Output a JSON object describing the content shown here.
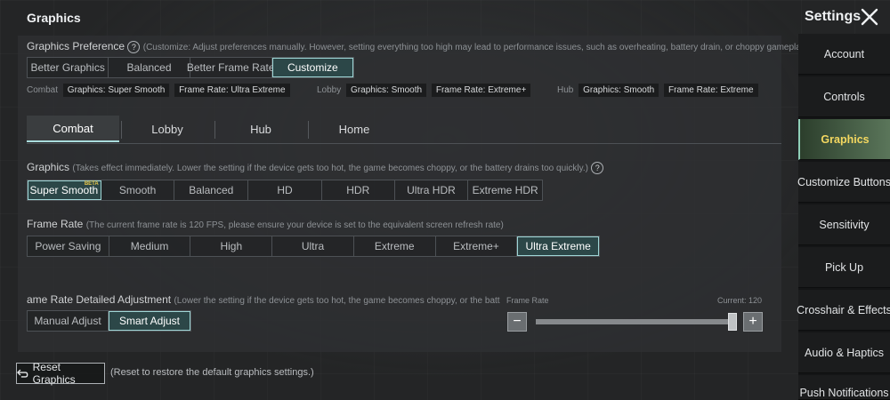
{
  "header": {
    "title": "Graphics",
    "settings_title": "Settings"
  },
  "preference": {
    "label": "Graphics Preference",
    "hint": "(Customize: Adjust preferences manually. However, setting everything too high may lead to performance issues, such as overheating, battery drain, or choppy gameplay.)",
    "options": [
      "Better Graphics",
      "Balanced",
      "Better Frame Rate",
      "Customize"
    ],
    "selected": "Customize",
    "summaries": {
      "combat": {
        "label": "Combat",
        "graphics": "Graphics: Super Smooth",
        "frame_rate": "Frame Rate: Ultra Extreme"
      },
      "lobby": {
        "label": "Lobby",
        "graphics": "Graphics: Smooth",
        "frame_rate": "Frame Rate: Extreme+"
      },
      "hub": {
        "label": "Hub",
        "graphics": "Graphics: Smooth",
        "frame_rate": "Frame Rate: Extreme"
      }
    }
  },
  "tabs": [
    "Combat",
    "Lobby",
    "Hub",
    "Home"
  ],
  "active_tab": "Combat",
  "graphics": {
    "label": "Graphics",
    "hint": "(Takes effect immediately. Lower the setting if the device gets too hot, the game becomes choppy, or the battery drains too quickly.)",
    "options": [
      "Super Smooth",
      "Smooth",
      "Balanced",
      "HD",
      "HDR",
      "Ultra HDR",
      "Extreme HDR"
    ],
    "selected": "Super Smooth",
    "beta_badge": "BETA"
  },
  "frame_rate": {
    "label": "Frame Rate",
    "hint": "(The current frame rate is 120 FPS, please ensure your device is set to the equivalent screen refresh rate)",
    "options": [
      "Power Saving",
      "Medium",
      "High",
      "Ultra",
      "Extreme",
      "Extreme+",
      "Ultra Extreme"
    ],
    "selected": "Ultra Extreme"
  },
  "detailed": {
    "label": "ame Rate Detailed Adjustment",
    "hint": "(Lower the setting if the device gets too hot, the game becomes choppy, or the battery drains",
    "options": [
      "Manual Adjust",
      "Smart Adjust"
    ],
    "selected": "Smart Adjust",
    "slider_label": "Frame Rate",
    "current_text": "Current: 120",
    "slider_fraction": 1.0,
    "minus": "−",
    "plus": "+"
  },
  "reset": {
    "label": "Reset Graphics",
    "note": "(Reset to restore the default graphics settings.)"
  },
  "sidebar": {
    "items": [
      "Account",
      "Controls",
      "Graphics",
      "Customize Buttons",
      "Sensitivity",
      "Pick Up",
      "Crosshair & Effects",
      "Audio & Haptics",
      "Push Notifications"
    ],
    "active": "Graphics"
  },
  "colors": {
    "accent": "#9fd6d6",
    "active_fill": "#2c4748",
    "sidebar_active_text": "#f4d860",
    "beta": "#e6c54a"
  },
  "icons": {
    "close": "close-icon",
    "help": "question-icon",
    "reset": "reset-arrow-icon"
  }
}
